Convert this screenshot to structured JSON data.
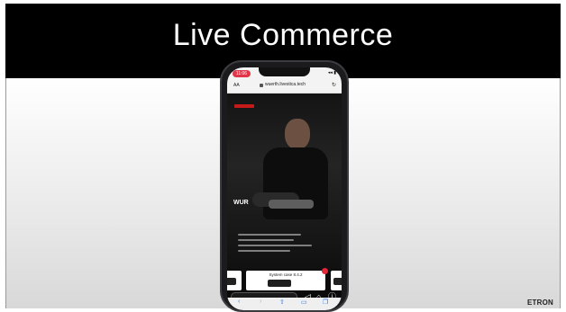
{
  "slide": {
    "title": "Live Commerce",
    "brand": "ETRON"
  },
  "phone": {
    "status_time": "11:06",
    "status_icons": "◂◂ ▮",
    "browser": {
      "text_size": "AA",
      "url": "wuerth.livestica.tech",
      "reload_icon": "reload-icon"
    },
    "video": {
      "overlay_title": "WUR"
    },
    "carousel": {
      "main_product": "System case 8.4.2"
    },
    "actions": [
      "share-icon",
      "bag-icon",
      "info-icon"
    ],
    "toolbar": [
      "back-icon",
      "forward-icon",
      "share-icon",
      "bookmarks-icon",
      "tabs-icon"
    ]
  },
  "colors": {
    "header_bg": "#000000",
    "badge": "#e3263a",
    "toolbar_icon": "#2277ee"
  }
}
